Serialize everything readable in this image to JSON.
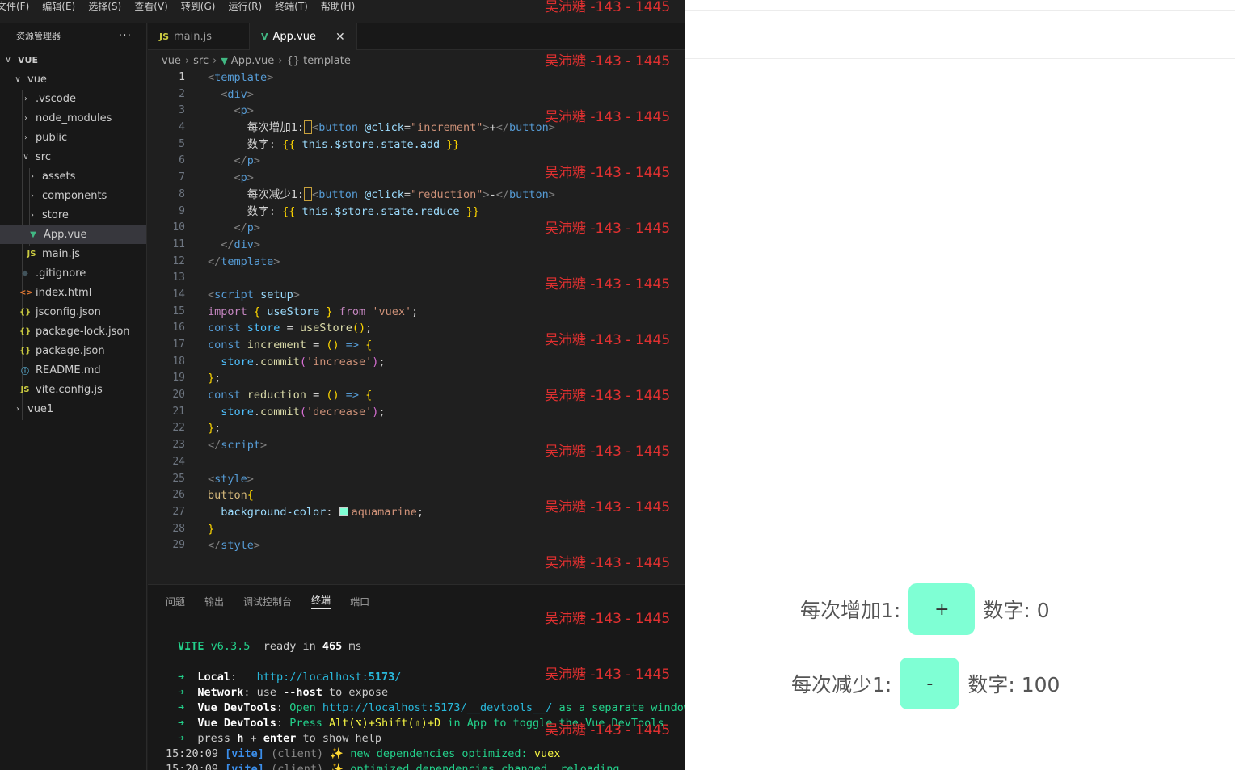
{
  "menubar": [
    "文件(F)",
    "编辑(E)",
    "选择(S)",
    "查看(V)",
    "转到(G)",
    "运行(R)",
    "终端(T)",
    "帮助(H)"
  ],
  "explorer": {
    "title": "资源管理器",
    "more": "···",
    "root": "VUE",
    "items": [
      "vue",
      ".vscode",
      "node_modules",
      "public",
      "src",
      "assets",
      "components",
      "store",
      "App.vue",
      "main.js",
      ".gitignore",
      "index.html",
      "jsconfig.json",
      "package-lock.json",
      "package.json",
      "README.md",
      "vite.config.js",
      "vue1"
    ]
  },
  "tabs": [
    {
      "label": "main.js",
      "icon": "JS"
    },
    {
      "label": "App.vue",
      "icon": "V",
      "close": "✕"
    }
  ],
  "breadcrumb": [
    "vue",
    "src",
    "App.vue",
    "{} template"
  ],
  "line_numbers": [
    "1",
    "2",
    "3",
    "4",
    "5",
    "6",
    "7",
    "8",
    "9",
    "10",
    "11",
    "12",
    "13",
    "14",
    "15",
    "16",
    "17",
    "18",
    "19",
    "20",
    "21",
    "22",
    "23",
    "24",
    "25",
    "26",
    "27",
    "28",
    "29"
  ],
  "code": {
    "l1": "template",
    "l2": "div",
    "l3": "p",
    "l4_text": "每次增加1:",
    "l4_tag": "button",
    "l4_attr": "@click",
    "l4_val": "\"increment\"",
    "l4_label": "+",
    "l5_text": "数字:",
    "l5_expr": "this.$store.state.add",
    "l8_text": "每次减少1:",
    "l8_val": "\"reduction\"",
    "l8_label": "-",
    "l9_expr": "this.$store.state.reduce",
    "l14_tag": "script",
    "l14_attr": "setup",
    "l15_kw": "import",
    "l15_id": "useStore",
    "l15_from": "from",
    "l15_str": "'vuex'",
    "l16_kw": "const",
    "l16_id": "store",
    "l16_fn": "useStore",
    "l17_id": "increment",
    "l18_obj": "store",
    "l18_fn": "commit",
    "l18_str": "'increase'",
    "l20_id": "reduction",
    "l21_str": "'decrease'",
    "l25_tag": "style",
    "l26_sel": "button",
    "l27_prop": "background-color",
    "l27_val": "aquamarine"
  },
  "panel": {
    "tabs": [
      "问题",
      "输出",
      "调试控制台",
      "终端",
      "端口"
    ],
    "active_tab": "终端",
    "vite_name": "VITE",
    "vite_version": "v6.3.5",
    "ready_text": "ready in",
    "ready_ms": "465",
    "ready_unit": "ms",
    "local_label": "Local",
    "local_url_a": "http://localhost:",
    "local_port": "5173",
    "network_label": "Network",
    "network_text": "use",
    "network_flag": "--host",
    "network_tail": "to expose",
    "devtools_label": "Vue DevTools",
    "devtools_open": "Open",
    "devtools_url_a": "http://localhost:",
    "devtools_url_b": "/__devtools__/",
    "devtools_tail": "as a separate window",
    "devtools2_press": "Press",
    "devtools2_keys": "Alt(⌥)+Shift(⇧)+D",
    "devtools2_tail": "in App to toggle the Vue DevTools",
    "help_press": "press",
    "help_h": "h",
    "help_plus": "+",
    "help_enter": "enter",
    "help_tail": "to show help",
    "log1_time": "15:20:09",
    "log1_tag": "[vite]",
    "log1_client": "(client)",
    "log1_msg": "new dependencies optimized:",
    "log1_dep": "vuex",
    "log2_time": "15:20:09",
    "log2_tag": "[vite]",
    "log2_client": "(client)",
    "log2_msg": "optimized dependencies changed. reloading"
  },
  "watermark": "吴沛糖 -143 - 1445",
  "preview": {
    "row1_label": "每次增加1:",
    "row1_button": "+",
    "row1_value": "数字: 0",
    "row2_label": "每次减少1:",
    "row2_button": "-",
    "row2_value": "数字: 100",
    "button_color": "#7fffd4"
  },
  "colors": {
    "editor_bg": "#1f1f1f",
    "sidebar_bg": "#181818",
    "vue_green": "#41b883",
    "js_yellow": "#cbcb41",
    "watermark": "#e03030"
  }
}
